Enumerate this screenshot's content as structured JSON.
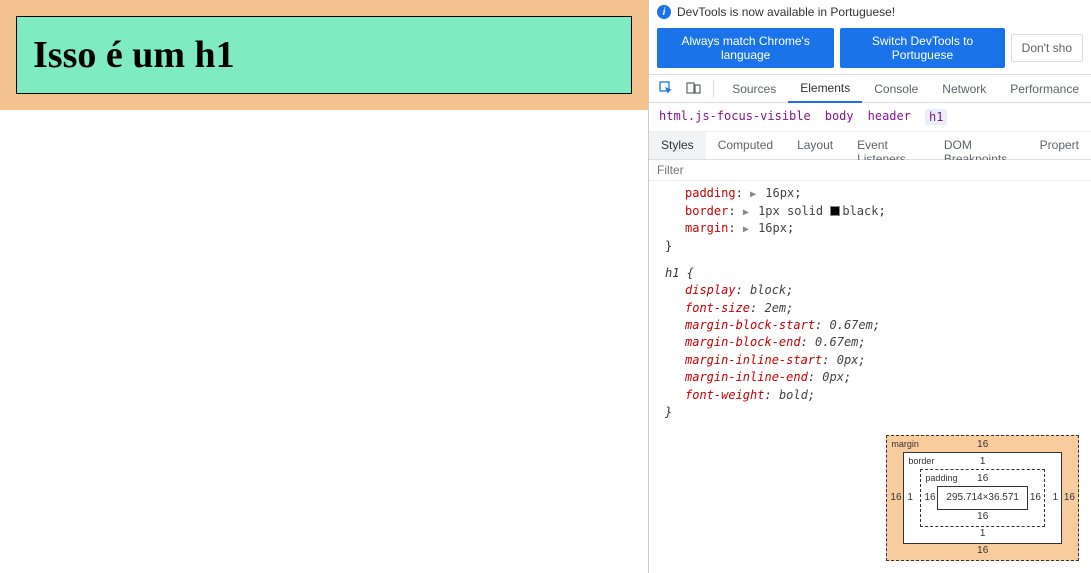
{
  "page": {
    "h1_text": "Isso é um h1"
  },
  "devtools": {
    "notice": "DevTools is now available in Portuguese!",
    "lang_buttons": {
      "always": "Always match Chrome's language",
      "switch": "Switch DevTools to Portuguese",
      "dont": "Don't sho"
    },
    "main_tabs": [
      "Sources",
      "Elements",
      "Console",
      "Network",
      "Performance"
    ],
    "main_tab_active": "Elements",
    "breadcrumb": [
      "html.js-focus-visible",
      "body",
      "header",
      "h1"
    ],
    "breadcrumb_active": "h1",
    "sub_tabs": [
      "Styles",
      "Computed",
      "Layout",
      "Event Listeners",
      "DOM Breakpoints",
      "Propert"
    ],
    "sub_tab_active": "Styles",
    "filter_placeholder": "Filter",
    "rules": {
      "authored": [
        {
          "prop": "padding",
          "tri": true,
          "val": "16px"
        },
        {
          "prop": "border",
          "tri": true,
          "val_parts": [
            "1px",
            "solid"
          ],
          "swatch": true,
          "val_after": "black"
        },
        {
          "prop": "margin",
          "tri": true,
          "val": "16px"
        }
      ],
      "ua_selector": "h1",
      "ua": [
        {
          "prop": "display",
          "val": "block"
        },
        {
          "prop": "font-size",
          "val": "2em"
        },
        {
          "prop": "margin-block-start",
          "val": "0.67em"
        },
        {
          "prop": "margin-block-end",
          "val": "0.67em"
        },
        {
          "prop": "margin-inline-start",
          "val": "0px"
        },
        {
          "prop": "margin-inline-end",
          "val": "0px"
        },
        {
          "prop": "font-weight",
          "val": "bold"
        }
      ]
    },
    "box_model": {
      "margin": {
        "label": "margin",
        "t": "16",
        "r": "16",
        "b": "16",
        "l": "16"
      },
      "border": {
        "label": "border",
        "t": "1",
        "r": "1",
        "b": "1",
        "l": "1"
      },
      "padding": {
        "label": "padding",
        "t": "16",
        "r": "16",
        "b": "16",
        "l": "16"
      },
      "content": "295.714×36.571"
    }
  }
}
